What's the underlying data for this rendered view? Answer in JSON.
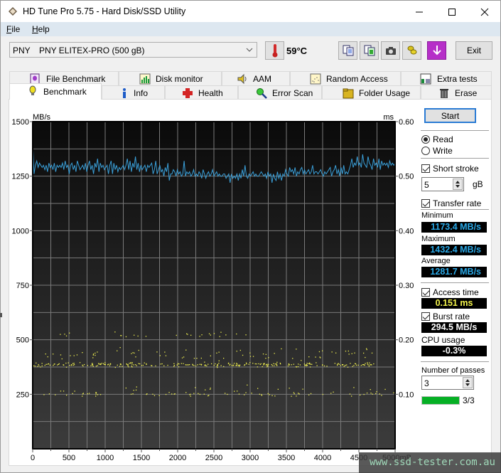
{
  "window": {
    "title": "HD Tune Pro 5.75 - Hard Disk/SSD Utility",
    "controls": [
      "minimize",
      "maximize",
      "close"
    ]
  },
  "menu": {
    "items": [
      {
        "label": "File",
        "accel": "F"
      },
      {
        "label": "Help",
        "accel": "H"
      }
    ]
  },
  "toolbar": {
    "drive_vendor": "PNY",
    "drive_model": "PNY ELITEX-PRO (500 gB)",
    "temperature": "59°C",
    "icons": [
      "thermometer-icon",
      "copy-text-icon",
      "copy-screenshot-icon",
      "camera-icon",
      "coins-icon",
      "download-icon"
    ],
    "exit_label": "Exit"
  },
  "tabs": {
    "row_top": [
      {
        "label": "File Benchmark",
        "icon": "file-benchmark-icon"
      },
      {
        "label": "Disk monitor",
        "icon": "disk-monitor-icon"
      },
      {
        "label": "AAM",
        "icon": "speaker-icon"
      },
      {
        "label": "Random Access",
        "icon": "random-access-icon"
      },
      {
        "label": "Extra tests",
        "icon": "extra-tests-icon"
      }
    ],
    "row_bottom": [
      {
        "label": "Benchmark",
        "icon": "lightbulb-icon",
        "active": true
      },
      {
        "label": "Info",
        "icon": "info-icon"
      },
      {
        "label": "Health",
        "icon": "health-cross-icon"
      },
      {
        "label": "Error Scan",
        "icon": "magnifier-icon"
      },
      {
        "label": "Folder Usage",
        "icon": "folder-icon"
      },
      {
        "label": "Erase",
        "icon": "trash-icon"
      }
    ]
  },
  "side_panel": {
    "start_label": "Start",
    "mode_options": [
      {
        "label": "Read",
        "selected": true
      },
      {
        "label": "Write",
        "selected": false
      }
    ],
    "short_stroke": {
      "label": "Short stroke",
      "checked": true,
      "value": "5",
      "unit": "gB"
    },
    "transfer_rate": {
      "label": "Transfer rate",
      "checked": true
    },
    "minimum": {
      "label": "Minimum",
      "value": "1173.4 MB/s"
    },
    "maximum": {
      "label": "Maximum",
      "value": "1432.4 MB/s"
    },
    "average": {
      "label": "Average",
      "value": "1281.7 MB/s"
    },
    "access_time": {
      "label": "Access time",
      "checked": true,
      "value": "0.151 ms"
    },
    "burst_rate": {
      "label": "Burst rate",
      "checked": true,
      "value": "294.5 MB/s"
    },
    "cpu_usage": {
      "label": "CPU usage",
      "value": "-0.3%"
    },
    "passes": {
      "label": "Number of passes",
      "value": "3",
      "progress": 1.0,
      "progress_text": "3/3"
    }
  },
  "watermark": "www.ssd-tester.com.au",
  "chart_data": {
    "type": "line",
    "title": "",
    "xlabel": "mB",
    "ylabel": "MB/s",
    "y2label": "ms",
    "xlim": [
      0,
      5000
    ],
    "ylim": [
      0,
      1500
    ],
    "y2lim": [
      0,
      0.6
    ],
    "x_ticks": [
      "0",
      "500",
      "1000",
      "1500",
      "2000",
      "2500",
      "3000",
      "3500",
      "4000",
      "4500",
      "5000mB"
    ],
    "y_ticks": [
      "1500",
      "1250",
      "1000",
      "750",
      "500",
      "250"
    ],
    "y2_ticks": [
      "0.60",
      "0.50",
      "0.40",
      "0.30",
      "0.20",
      "0.10"
    ],
    "grid": true,
    "colors": {
      "transfer": "#3a9fd8",
      "access": "#f0f050",
      "bg_top": "#0a0a0a",
      "bg_bottom": "#3c3c3c",
      "grid": "#7a7a7a"
    },
    "series": [
      {
        "name": "Transfer rate (MB/s)",
        "x_step": 50,
        "values": [
          1410,
          1260,
          1300,
          1320,
          1290,
          1310,
          1300,
          1290,
          1300,
          1280,
          1300,
          1270,
          1310,
          1290,
          1300,
          1280,
          1310,
          1270,
          1300,
          1290,
          1300,
          1290,
          1310,
          1280,
          1320,
          1290,
          1300,
          1260,
          1300,
          1310,
          1280,
          1300,
          1270,
          1320,
          1300,
          1280,
          1290,
          1300,
          1280,
          1310,
          1270,
          1300,
          1320,
          1280,
          1300,
          1260,
          1310,
          1290,
          1330,
          1270,
          1310,
          1290,
          1300,
          1280,
          1290,
          1300,
          1260,
          1300,
          1320,
          1260,
          1310,
          1280,
          1300,
          1270,
          1290,
          1280,
          1290,
          1300,
          1280,
          1300,
          1330,
          1280,
          1320,
          1270,
          1310,
          1290,
          1340,
          1280,
          1310,
          1270,
          1300,
          1280,
          1290,
          1300,
          1270,
          1300,
          1290,
          1300,
          1310,
          1260,
          1280,
          1320,
          1260,
          1280,
          1300,
          1270,
          1280,
          1250,
          1290,
          1270,
          1310,
          1230,
          1260,
          1260,
          1280,
          1270,
          1250,
          1280,
          1260,
          1270,
          1250,
          1260,
          1320,
          1250,
          1270,
          1260,
          1270,
          1250,
          1260,
          1280,
          1250,
          1260,
          1250,
          1270,
          1260,
          1240,
          1280,
          1260,
          1240,
          1260,
          1270,
          1250,
          1260,
          1280,
          1250,
          1260,
          1270,
          1250,
          1260,
          1250,
          1250,
          1260,
          1260,
          1240,
          1250,
          1260,
          1220,
          1260,
          1240,
          1250,
          1240,
          1260,
          1230,
          1260,
          1240,
          1280,
          1250,
          1300,
          1250,
          1240,
          1260,
          1250,
          1260,
          1270,
          1250,
          1260,
          1250,
          1250,
          1260,
          1270,
          1260,
          1250,
          1260,
          1240,
          1270,
          1250,
          1260,
          1220,
          1260,
          1240,
          1230,
          1270,
          1240,
          1260,
          1230,
          1260,
          1250,
          1280,
          1260,
          1250,
          1290,
          1270,
          1280,
          1260,
          1290,
          1250,
          1270,
          1260,
          1280,
          1290,
          1260,
          1280,
          1260,
          1270,
          1280,
          1260,
          1270,
          1300,
          1260,
          1270,
          1270,
          1260,
          1270,
          1280,
          1260,
          1250,
          1270,
          1260,
          1270,
          1280,
          1290,
          1250,
          1270,
          1280,
          1300,
          1260,
          1280,
          1250,
          1290,
          1260,
          1300,
          1260,
          1270,
          1260,
          1280,
          1300,
          1330,
          1290,
          1310,
          1300,
          1340,
          1300,
          1310,
          1290,
          1350,
          1310,
          1300,
          1290,
          1340,
          1310,
          1300,
          1280,
          1330,
          1300,
          1310,
          1290,
          1330,
          1280,
          1320,
          1300,
          1310,
          1300,
          1310,
          1290,
          1320,
          1300,
          1310,
          1300,
          1310
        ]
      },
      {
        "name": "Access time (ms)",
        "type": "scatter",
        "clusters": [
          {
            "center_ms": 0.155,
            "spread_ms": 0.006,
            "x_range": [
              0,
              4750
            ],
            "density": "high"
          },
          {
            "center_ms": 0.175,
            "spread_ms": 0.015,
            "x_range": [
              0,
              4750
            ],
            "density": "medium"
          },
          {
            "center_ms": 0.21,
            "spread_ms": 0.008,
            "x_range": [
              100,
              3100
            ],
            "density": "low"
          },
          {
            "center_ms": 0.101,
            "spread_ms": 0.005,
            "x_range": [
              0,
              5000
            ],
            "density": "medium"
          },
          {
            "center_ms": 0.11,
            "spread_ms": 0.012,
            "x_range": [
              0,
              5000
            ],
            "density": "low"
          }
        ]
      }
    ]
  }
}
